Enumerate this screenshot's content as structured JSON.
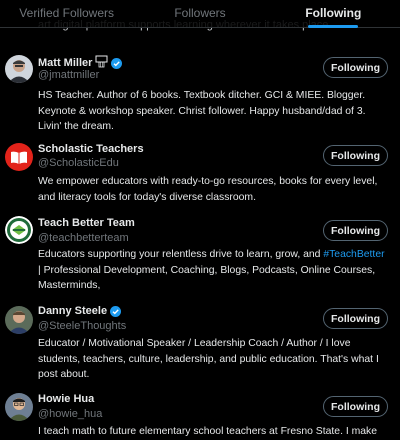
{
  "tabs": [
    {
      "label": "Verified Followers",
      "active": false
    },
    {
      "label": "Followers",
      "active": false
    },
    {
      "label": "Following",
      "active": true
    }
  ],
  "previous_bio_tail": "art digital platform supports learning wherever it takes place.",
  "users": [
    {
      "name": "Matt Miller",
      "handle": "@jmattmiller",
      "verified": true,
      "badge": "basketball-hoop-emoji",
      "bio": "HS Teacher. Author of 6 books. Textbook ditcher. GCI & MIEE. Blogger. Keynote & workshop speaker. Christ follower. Happy husband/dad of 3. Livin' the dream.",
      "button": "Following"
    },
    {
      "name": "Scholastic Teachers",
      "handle": "@ScholasticEdu",
      "verified": false,
      "bio": "We empower educators with ready-to-go resources, books for every level, and literacy tools for today's diverse classroom.",
      "button": "Following"
    },
    {
      "name": "Teach Better Team",
      "handle": "@teachbetterteam",
      "verified": false,
      "bio_pre": "Educators supporting your relentless drive to learn, grow, and ",
      "bio_link": "#TeachBetter",
      "bio_post": " | Professional Development, Coaching, Blogs, Podcasts, Online Courses, Masterminds,",
      "button": "Following"
    },
    {
      "name": "Danny Steele",
      "handle": "@SteeleThoughts",
      "verified": true,
      "bio": "Educator / Motivational Speaker / Leadership Coach / Author / I love students, teachers, culture, leadership, and public education. That's what I post about.",
      "button": "Following"
    },
    {
      "name": "Howie Hua",
      "handle": "@howie_hua",
      "verified": false,
      "bio": "I teach math to future elementary school teachers at Fresno State. I make",
      "button": "Following"
    }
  ],
  "colors": {
    "background": "#000000",
    "text": "#e7e9ea",
    "muted": "#71767b",
    "accent": "#1d9bf0",
    "border": "#2f3336"
  }
}
